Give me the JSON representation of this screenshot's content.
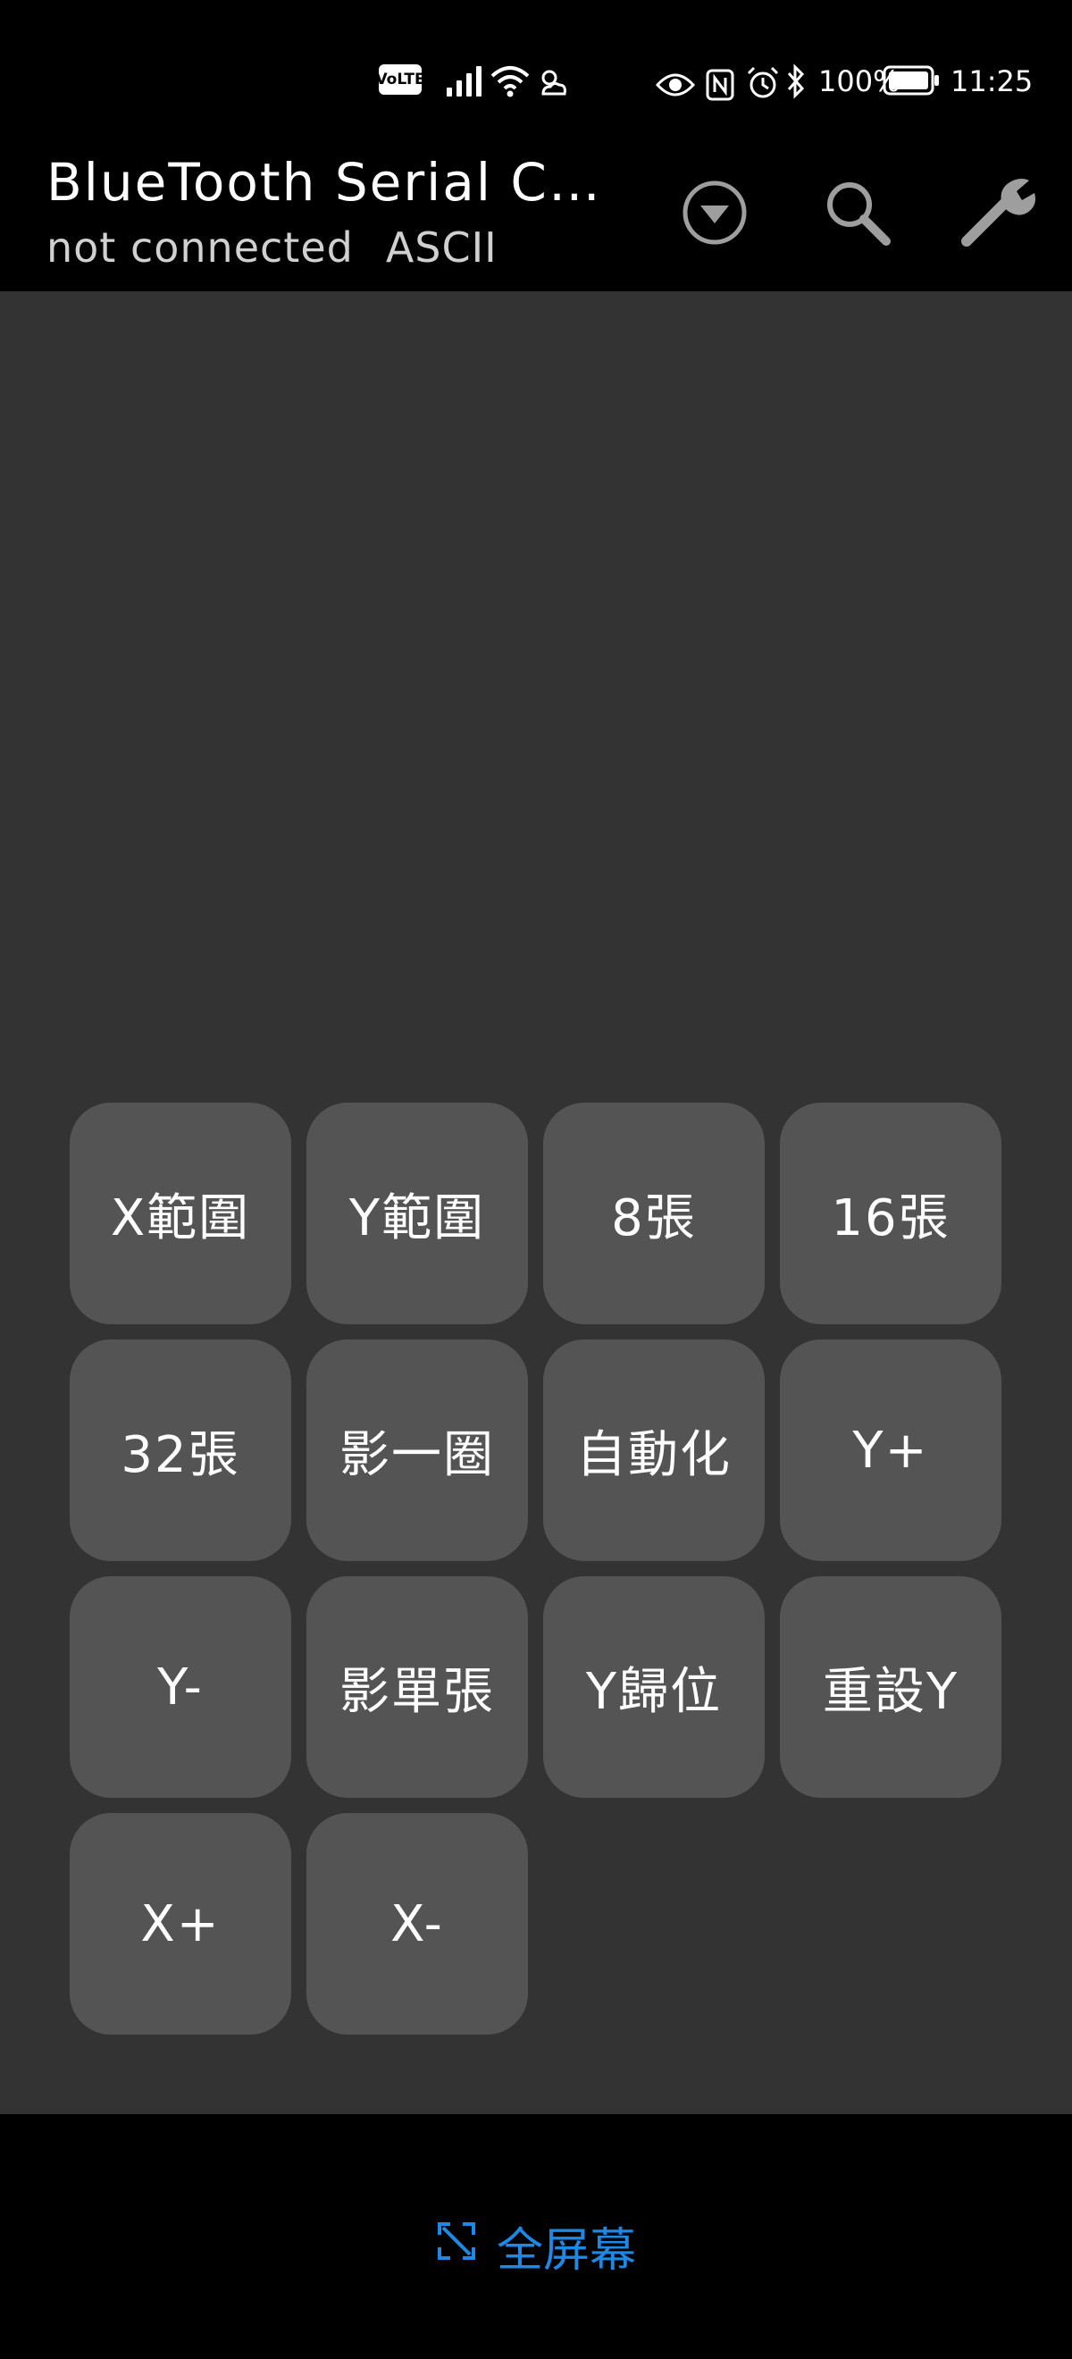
{
  "status_bar": {
    "volte": "VoLTE",
    "battery_percent": "100%",
    "time": "11:25",
    "icons": [
      "signal-icon",
      "wifi-icon",
      "weather-icon",
      "eye-icon",
      "nfc-icon",
      "alarm-icon",
      "bluetooth-icon",
      "battery-icon"
    ]
  },
  "app_bar": {
    "title": "BlueTooth Serial C…",
    "connection_status": "not connected",
    "mode": "ASCII",
    "actions": [
      "dropdown-icon",
      "search-icon",
      "settings-icon"
    ]
  },
  "buttons": [
    {
      "label": "X範圍"
    },
    {
      "label": "Y範圍"
    },
    {
      "label": "8張"
    },
    {
      "label": "16張"
    },
    {
      "label": "32張"
    },
    {
      "label": "影一圈"
    },
    {
      "label": "自動化"
    },
    {
      "label": "Y+"
    },
    {
      "label": "Y-"
    },
    {
      "label": "影單張"
    },
    {
      "label": "Y歸位"
    },
    {
      "label": "重設Y"
    },
    {
      "label": "X+"
    },
    {
      "label": "X-"
    }
  ],
  "bottom_bar": {
    "fullscreen_label": "全屏幕"
  },
  "colors": {
    "background": "#333333",
    "button": "#545454",
    "bars": "#000000",
    "accent": "#1e88e5"
  }
}
